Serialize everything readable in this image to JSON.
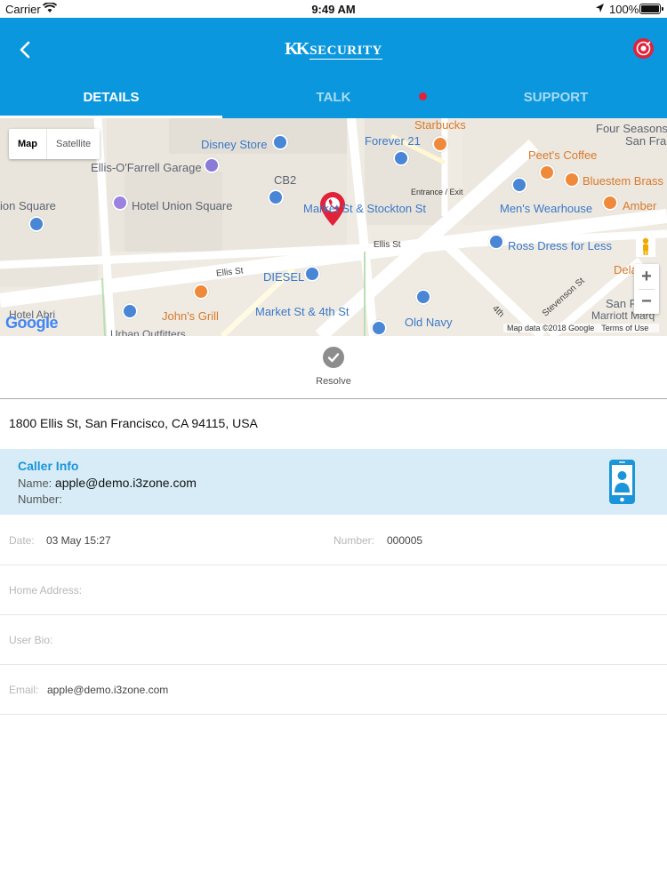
{
  "status_bar": {
    "carrier": "Carrier",
    "time": "9:49 AM",
    "battery": "100%"
  },
  "header": {
    "logo_mark": "KK",
    "logo_text": "SECURITY"
  },
  "tabs": [
    {
      "label": "DETAILS",
      "active": true
    },
    {
      "label": "TALK",
      "active": false,
      "has_badge": true
    },
    {
      "label": "SUPPORT",
      "active": false
    }
  ],
  "map": {
    "type_options": [
      "Map",
      "Satellite"
    ],
    "selected_type": "Map",
    "labels": {
      "disney": "Disney Store",
      "forever21": "Forever 21",
      "starbucks": "Starbucks",
      "four_seasons": "Four Seasons",
      "san_fra": "San Fra",
      "peets": "Peet's Coffee",
      "bluestem": "Bluestem Brass",
      "ellis_garage": "Ellis-O'Farrell Garage",
      "cb2": "CB2",
      "entrance": "Entrance / Exit",
      "mens": "Men's Wearhouse",
      "amber": "Amber",
      "union_square_left": "ion Square",
      "hotel_union": "Hotel Union Square",
      "market_stockton": "Market St & Stockton St",
      "ellis_st_right": "Ellis St",
      "ross": "Ross Dress for Less",
      "dela": "Dela",
      "ellis_st_left": "Ellis St",
      "diesel": "DIESEL",
      "stevenson": "Stevenson St",
      "johns_grill": "John's Grill",
      "market_4th": "Market St & 4th St",
      "old_navy": "Old Navy",
      "fourth": "4th",
      "san_fr2": "San Fr",
      "marriott": "Marriott Marq",
      "hotel_abri": "Hotel Abri",
      "urban": "Urban Outfitters"
    },
    "attribution": "Map data ©2018 Google",
    "terms": "Terms of Use",
    "google": "Google"
  },
  "resolve": {
    "label": "Resolve"
  },
  "address": "1800 Ellis St, San Francisco, CA 94115, USA",
  "caller_info": {
    "title": "Caller Info",
    "name_label": "Name:",
    "name_value": "apple@demo.i3zone.com",
    "number_label": "Number:"
  },
  "details": {
    "date_label": "Date:",
    "date_value": "03 May 15:27",
    "number_label": "Number:",
    "number_value": "000005",
    "home_label": "Home Address:",
    "bio_label": "User Bio:",
    "email_label": "Email:",
    "email_value": "apple@demo.i3zone.com"
  },
  "colors": {
    "brand_blue": "#0b97dd",
    "caller_bg": "#d7ecf7",
    "pin_red": "#e0223a"
  }
}
